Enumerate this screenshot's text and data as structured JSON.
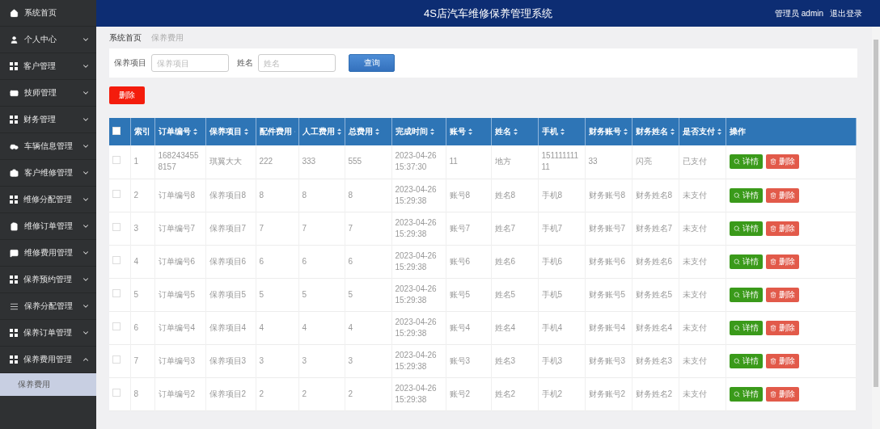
{
  "header": {
    "title": "4S店汽车维修保养管理系统",
    "user": "管理员 admin",
    "logout": "退出登录"
  },
  "sidebar": {
    "items": [
      {
        "label": "系统首页",
        "kind": "link"
      },
      {
        "label": "个人中心",
        "kind": "menu",
        "expanded": false
      },
      {
        "label": "客户管理",
        "kind": "menu",
        "expanded": false
      },
      {
        "label": "技师管理",
        "kind": "menu",
        "expanded": false
      },
      {
        "label": "财务管理",
        "kind": "menu",
        "expanded": false
      },
      {
        "label": "车辆信息管理",
        "kind": "menu",
        "expanded": false
      },
      {
        "label": "客户维修管理",
        "kind": "menu",
        "expanded": false
      },
      {
        "label": "维修分配管理",
        "kind": "menu",
        "expanded": false
      },
      {
        "label": "维修订单管理",
        "kind": "menu",
        "expanded": false
      },
      {
        "label": "维修费用管理",
        "kind": "menu",
        "expanded": false
      },
      {
        "label": "保养预约管理",
        "kind": "menu",
        "expanded": false
      },
      {
        "label": "保养分配管理",
        "kind": "menu",
        "expanded": false
      },
      {
        "label": "保养订单管理",
        "kind": "menu",
        "expanded": false
      },
      {
        "label": "保养费用管理",
        "kind": "menu",
        "expanded": true,
        "children": [
          {
            "label": "保养费用",
            "selected": true
          }
        ]
      }
    ]
  },
  "breadcrumb": [
    "系统首页",
    "保养费用"
  ],
  "search": {
    "fields": [
      {
        "label": "保养项目",
        "placeholder": "保养项目"
      },
      {
        "label": "姓名",
        "placeholder": "姓名"
      }
    ],
    "button": "查询"
  },
  "delete_button": "删除",
  "table": {
    "select_all": {
      "checked": false
    },
    "columns": [
      {
        "label": "索引",
        "sortable": false
      },
      {
        "label": "订单编号",
        "sortable": true
      },
      {
        "label": "保养项目",
        "sortable": true
      },
      {
        "label": "配件费用",
        "sortable": true
      },
      {
        "label": "人工费用",
        "sortable": true
      },
      {
        "label": "总费用",
        "sortable": true
      },
      {
        "label": "完成时间",
        "sortable": true
      },
      {
        "label": "账号",
        "sortable": true
      },
      {
        "label": "姓名",
        "sortable": true
      },
      {
        "label": "手机",
        "sortable": true
      },
      {
        "label": "财务账号",
        "sortable": true
      },
      {
        "label": "财务姓名",
        "sortable": true
      },
      {
        "label": "是否支付",
        "sortable": true
      },
      {
        "label": "操作",
        "sortable": false
      }
    ],
    "rows": [
      {
        "checked": false,
        "cells": [
          "1",
          "1682434558157",
          "琪翼大大",
          "222",
          "333",
          "555",
          "2023-04-26 15:37:30",
          "11",
          "地方",
          "15111111111",
          "33",
          "闪亮",
          "已支付"
        ],
        "actions": [
          {
            "kind": "detail",
            "label": "详情"
          },
          {
            "kind": "delete",
            "label": "删除"
          }
        ]
      },
      {
        "checked": false,
        "cells": [
          "2",
          "订单编号8",
          "保养项目8",
          "8",
          "8",
          "8",
          "2023-04-26 15:29:38",
          "账号8",
          "姓名8",
          "手机8",
          "财务账号8",
          "财务姓名8",
          "未支付"
        ],
        "actions": [
          {
            "kind": "detail",
            "label": "详情"
          },
          {
            "kind": "delete",
            "label": "删除"
          }
        ]
      },
      {
        "checked": false,
        "cells": [
          "3",
          "订单编号7",
          "保养项目7",
          "7",
          "7",
          "7",
          "2023-04-26 15:29:38",
          "账号7",
          "姓名7",
          "手机7",
          "财务账号7",
          "财务姓名7",
          "未支付"
        ],
        "actions": [
          {
            "kind": "detail",
            "label": "详情"
          },
          {
            "kind": "delete",
            "label": "删除"
          }
        ]
      },
      {
        "checked": false,
        "cells": [
          "4",
          "订单编号6",
          "保养项目6",
          "6",
          "6",
          "6",
          "2023-04-26 15:29:38",
          "账号6",
          "姓名6",
          "手机6",
          "财务账号6",
          "财务姓名6",
          "未支付"
        ],
        "actions": [
          {
            "kind": "detail",
            "label": "详情"
          },
          {
            "kind": "delete",
            "label": "删除"
          }
        ]
      },
      {
        "checked": false,
        "cells": [
          "5",
          "订单编号5",
          "保养项目5",
          "5",
          "5",
          "5",
          "2023-04-26 15:29:38",
          "账号5",
          "姓名5",
          "手机5",
          "财务账号5",
          "财务姓名5",
          "未支付"
        ],
        "actions": [
          {
            "kind": "detail",
            "label": "详情"
          },
          {
            "kind": "delete",
            "label": "删除"
          }
        ]
      },
      {
        "checked": false,
        "cells": [
          "6",
          "订单编号4",
          "保养项目4",
          "4",
          "4",
          "4",
          "2023-04-26 15:29:38",
          "账号4",
          "姓名4",
          "手机4",
          "财务账号4",
          "财务姓名4",
          "未支付"
        ],
        "actions": [
          {
            "kind": "detail",
            "label": "详情"
          },
          {
            "kind": "delete",
            "label": "删除"
          }
        ]
      },
      {
        "checked": false,
        "cells": [
          "7",
          "订单编号3",
          "保养项目3",
          "3",
          "3",
          "3",
          "2023-04-26 15:29:38",
          "账号3",
          "姓名3",
          "手机3",
          "财务账号3",
          "财务姓名3",
          "未支付"
        ],
        "actions": [
          {
            "kind": "detail",
            "label": "详情"
          },
          {
            "kind": "delete",
            "label": "删除"
          }
        ]
      },
      {
        "checked": false,
        "cells": [
          "8",
          "订单编号2",
          "保养项目2",
          "2",
          "2",
          "2",
          "2023-04-26 15:29:38",
          "账号2",
          "姓名2",
          "手机2",
          "财务账号2",
          "财务姓名2",
          "未支付"
        ],
        "actions": [
          {
            "kind": "detail",
            "label": "详情"
          },
          {
            "kind": "delete",
            "label": "删除"
          }
        ]
      }
    ]
  }
}
